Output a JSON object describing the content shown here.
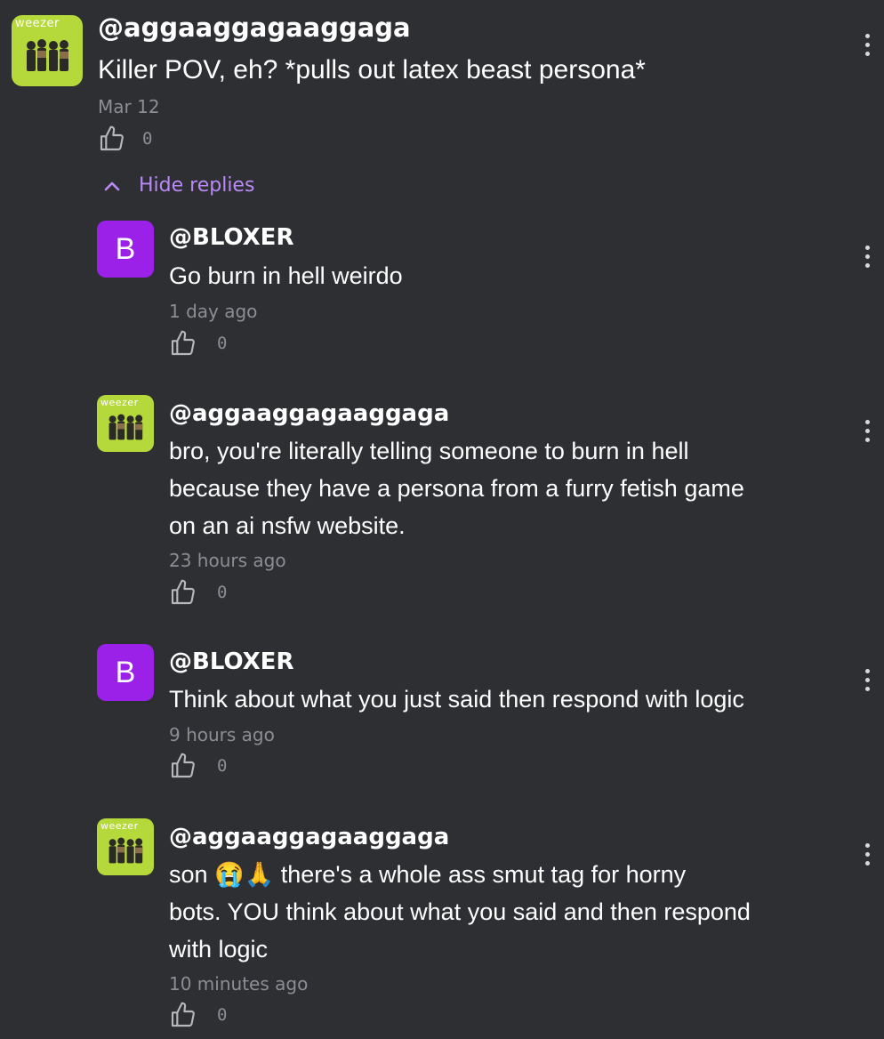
{
  "hide_replies_label": "Hide replies",
  "album_avatar_text": "weezer",
  "comments": [
    {
      "username": "@aggaaggagaaggaga",
      "text": "Killer POV, eh? *pulls out latex beast persona*",
      "time": "Mar 12",
      "likes": "0",
      "avatar": "album"
    },
    {
      "username": "@BLOXER",
      "avatar_letter": "B",
      "text": "Go burn in hell weirdo",
      "time": "1 day ago",
      "likes": "0",
      "avatar": "letter"
    },
    {
      "username": "@aggaaggagaaggaga",
      "text_lines": [
        "bro, you're literally telling someone to burn in hell",
        "because they have a persona from a furry fetish game",
        "on an ai nsfw website."
      ],
      "time": "23 hours ago",
      "likes": "0",
      "avatar": "album"
    },
    {
      "username": "@BLOXER",
      "avatar_letter": "B",
      "text": "Think about what you just said then respond with logic",
      "time": "9 hours ago",
      "likes": "0",
      "avatar": "letter"
    },
    {
      "username": "@aggaaggagaaggaga",
      "text_lines": [
        "son 😭🙏 there's a whole ass smut tag for horny",
        "bots. YOU think about what you said and then respond",
        "with logic"
      ],
      "time": "10 minutes ago",
      "likes": "0",
      "avatar": "album"
    }
  ],
  "colors": {
    "background": "#2e2f33",
    "accent": "#b98af6",
    "avatar_purple": "#9b20e8",
    "album_green": "#b5d83a"
  }
}
